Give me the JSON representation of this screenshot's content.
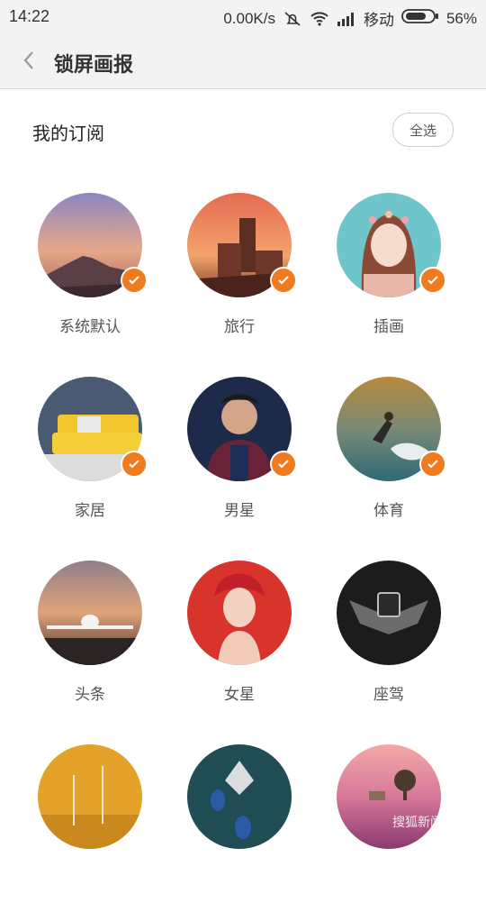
{
  "status": {
    "time": "14:22",
    "speed": "0.00K/s",
    "carrier": "移动",
    "battery": "56%"
  },
  "header": {
    "title": "锁屏画报"
  },
  "section": {
    "title": "我的订阅",
    "select_all": "全选"
  },
  "categories": [
    {
      "label": "系统默认",
      "checked": true
    },
    {
      "label": "旅行",
      "checked": true
    },
    {
      "label": "插画",
      "checked": true
    },
    {
      "label": "家居",
      "checked": true
    },
    {
      "label": "男星",
      "checked": true
    },
    {
      "label": "体育",
      "checked": true
    },
    {
      "label": "头条",
      "checked": false
    },
    {
      "label": "女星",
      "checked": false
    },
    {
      "label": "座驾",
      "checked": false
    },
    {
      "label": "",
      "checked": false
    },
    {
      "label": "",
      "checked": false
    },
    {
      "label": "",
      "checked": false
    }
  ],
  "colors": {
    "accent": "#f07a1e"
  },
  "watermark": {
    "text": "搜狐新闻"
  }
}
